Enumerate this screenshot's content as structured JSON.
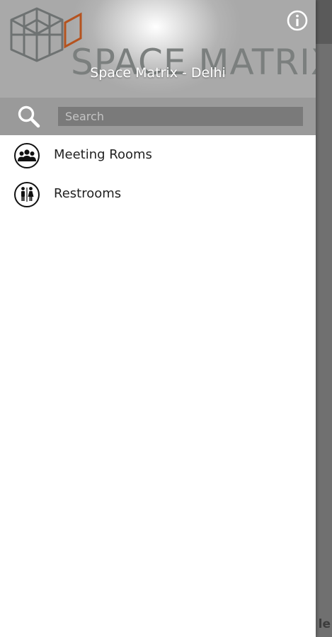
{
  "header": {
    "brand_text": "SPACE MATRIX",
    "title": "Space Matrix - Delhi",
    "info_icon": "info-circle-icon"
  },
  "search": {
    "placeholder": "Search",
    "value": "",
    "icon": "search-icon"
  },
  "menu": {
    "items": [
      {
        "label": "Meeting Rooms",
        "icon": "group-icon"
      },
      {
        "label": "Restrooms",
        "icon": "restroom-icon"
      }
    ]
  },
  "background": {
    "partial_text": "le"
  },
  "colors": {
    "header_bg": "#a9a9a9",
    "search_bar_bg": "#9a9a9a",
    "search_input_bg": "#7a7a7a",
    "logo_accent": "#b5531f",
    "logo_gray": "#6e7272",
    "backdrop": "#707070"
  }
}
